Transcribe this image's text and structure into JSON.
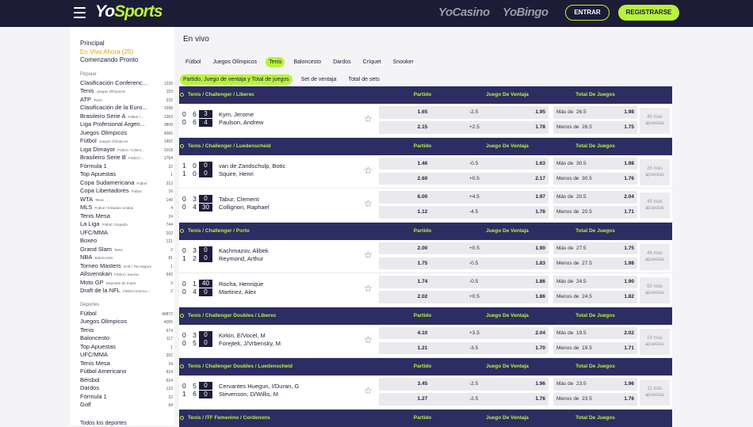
{
  "header": {
    "logo_a": "Yo",
    "logo_b": "Sports",
    "casino": "YoCasino",
    "bingo": "YoBingo",
    "login": "ENTRAR",
    "register": "REGISTRARSE"
  },
  "sidebar": {
    "top": [
      "Principal",
      "En Vivo Ahora (25)",
      "Comenzando Pronto"
    ],
    "popular_title": "Popular",
    "popular": [
      {
        "name": "Clasificación Conferenc...",
        "sub": "",
        "count": "1226"
      },
      {
        "name": "Tenis",
        "sub": "Juegos Olímpicos",
        "count": "153"
      },
      {
        "name": "ATP",
        "sub": "Tenis",
        "count": "232"
      },
      {
        "name": "Clasificación de la Euro...",
        "sub": "",
        "count": "1098"
      },
      {
        "name": "Brasileiro Serie A",
        "sub": "Fútbol /...",
        "count": "1363"
      },
      {
        "name": "Liga Profesional Argen...",
        "sub": "",
        "count": "3809"
      },
      {
        "name": "Juegos Olimpicos",
        "sub": "",
        "count": "4065"
      },
      {
        "name": "Fútbol",
        "sub": "Juegos Olímpicos",
        "count": "1452"
      },
      {
        "name": "Liga Dimayor",
        "sub": "Fútbol / Colom...",
        "count": "1018"
      },
      {
        "name": "Brasileiro Serie B",
        "sub": "Fútbol /...",
        "count": "1754"
      },
      {
        "name": "Fórmula 1",
        "sub": "",
        "count": "22"
      },
      {
        "name": "Top Apuestas",
        "sub": "",
        "count": "1"
      },
      {
        "name": "Copa Sudamericana",
        "sub": "Fútbol",
        "count": "313"
      },
      {
        "name": "Copa Libertadores",
        "sub": "Fútbol",
        "count": "19"
      },
      {
        "name": "WTA",
        "sub": "Tenis",
        "count": "140"
      },
      {
        "name": "MLS",
        "sub": "Fútbol / Estados Unidos",
        "count": "4"
      },
      {
        "name": "Tenis Mesa",
        "sub": "",
        "count": "24"
      },
      {
        "name": "La Liga",
        "sub": "Fútbol / España",
        "count": "744"
      },
      {
        "name": "UFC/MMA",
        "sub": "",
        "count": "202"
      },
      {
        "name": "Boxeo",
        "sub": "",
        "count": "121"
      },
      {
        "name": "Grand Slam",
        "sub": "Tenis",
        "count": "2"
      },
      {
        "name": "NBA",
        "sub": "Baloncesto",
        "count": "81"
      },
      {
        "name": "Torneo Masters",
        "sub": "Golf / The Majors",
        "count": "1"
      },
      {
        "name": "Allsvenskan",
        "sub": "Fútbol / Suecia",
        "count": "642"
      },
      {
        "name": "Moto GP",
        "sub": "Deportes de motor",
        "count": "3"
      },
      {
        "name": "Draft de la NFL",
        "sub": "Fútbol Americo...",
        "count": "2"
      }
    ],
    "sports_title": "Deportes",
    "sports": [
      {
        "name": "Fútbol",
        "count": "49872"
      },
      {
        "name": "Juegos Olimpicos",
        "count": "4065"
      },
      {
        "name": "Tenis",
        "count": "674"
      },
      {
        "name": "Baloncesto",
        "count": "117"
      },
      {
        "name": "Top Apuestas",
        "count": "1"
      },
      {
        "name": "UFC/MMA",
        "count": "202"
      },
      {
        "name": "Tenis Mesa",
        "count": "24"
      },
      {
        "name": "Fútbol Americano",
        "count": "824"
      },
      {
        "name": "Béisbol",
        "count": "524"
      },
      {
        "name": "Dardos",
        "count": "123"
      },
      {
        "name": "Fórmula 1",
        "count": "22"
      },
      {
        "name": "Golf",
        "count": "64"
      }
    ],
    "all_sports": "Todos los deportes"
  },
  "main": {
    "title": "En vivo",
    "sport_tabs": [
      "Fútbol",
      "Juegos Olímpicos",
      "Tenis",
      "Baloncesto",
      "Dardos",
      "Críquet",
      "Snooker"
    ],
    "market_tabs": [
      "Partido, Juego de ventaja y Total de juegos",
      "Set de ventaja",
      "Total de sets"
    ],
    "col_partido": "Partido",
    "col_ventaja": "Juego De Ventaja",
    "col_total": "Total De Juegos",
    "over": "Más de",
    "under": "Menos de"
  },
  "groups": [
    {
      "league": "Tenis / Challenger / Liberec",
      "matches": [
        {
          "s1": "06",
          "s2": "06",
          "c1": "3",
          "c2": "4",
          "p1": "Kym, Jerome",
          "p2": "Paulson, Andrew",
          "o1": "1.65",
          "o2": "2.15",
          "h1": "-2.5",
          "h1o": "1.95",
          "h2": "+2.5",
          "h2o": "1.78",
          "t1": "26.5",
          "t1o": "1.98",
          "t2": "26.5",
          "t2o": "1.75",
          "more": "40 más apuestas"
        }
      ]
    },
    {
      "league": "Tenis / Challenger / Luedenscheid",
      "matches": [
        {
          "s1": "10",
          "s2": "10",
          "c1": "0",
          "c2": "0",
          "p1": "van de Zandschulp, Botic",
          "p2": "Squire, Henri",
          "o1": "1.46",
          "o2": "2.60",
          "h1": "-0.5",
          "h1o": "1.63",
          "h2": "+0.5",
          "h2o": "2.17",
          "t1": "30.5",
          "t1o": "1.98",
          "t2": "30.5",
          "t2o": "1.76",
          "more": "26 más apuestas"
        },
        {
          "s1": "03",
          "s2": "04",
          "c1": "0",
          "c2": "30",
          "p1": "Tabur, Clement",
          "p2": "Collignon, Raphael",
          "o1": "6.00",
          "o2": "1.12",
          "h1": "+4.5",
          "h1o": "1.97",
          "h2": "-4.5",
          "h2o": "1.76",
          "t1": "20.5",
          "t1o": "2.04",
          "t2": "20.5",
          "t2o": "1.71",
          "more": "45 más apuestas"
        }
      ]
    },
    {
      "league": "Tenis / Challenger / Porto",
      "matches": [
        {
          "s1": "03",
          "s2": "12",
          "c1": "0",
          "c2": "0",
          "p1": "Kachmazov, Alibek",
          "p2": "Reymond, Arthur",
          "o1": "2.00",
          "o2": "1.75",
          "h1": "+0.5",
          "h1o": "1.90",
          "h2": "-0.5",
          "h2o": "1.83",
          "t1": "27.5",
          "t1o": "1.75",
          "t2": "27.5",
          "t2o": "1.98",
          "more": "46 más apuestas"
        },
        {
          "s1": "01",
          "s2": "04",
          "c1": "40",
          "c2": "0",
          "p1": "Rocha, Henrique",
          "p2": "Martinez, Alex",
          "o1": "1.74",
          "o2": "2.02",
          "h1": "-0.5",
          "h1o": "1.86",
          "h2": "+0.5",
          "h2o": "1.86",
          "t1": "24.5",
          "t1o": "1.90",
          "t2": "24.5",
          "t2o": "1.82",
          "more": "50 más apuestas"
        }
      ]
    },
    {
      "league": "Tenis / Challenger Doubles / Liberec",
      "matches": [
        {
          "s1": "03",
          "s2": "05",
          "c1": "0",
          "c2": "0",
          "p1": "Kirkin, E/Vocel, M",
          "p2": "Forejtek, J/Vrbensky, M",
          "o1": "4.10",
          "o2": "1.21",
          "h1": "+3.5",
          "h1o": "2.04",
          "h2": "-3.5",
          "h2o": "1.70",
          "t1": "19.5",
          "t1o": "2.02",
          "t2": "19.5",
          "t2o": "1.71",
          "more": "19 más apuestas"
        }
      ]
    },
    {
      "league": "Tenis / Challenger Doubles / Luedenscheid",
      "matches": [
        {
          "s1": "05",
          "s2": "16",
          "c1": "0",
          "c2": "0",
          "p1": "Cervantes Huegun, I/Duran, G",
          "p2": "Stevenson, D/Willis, M",
          "o1": "3.45",
          "o2": "1.27",
          "h1": "-2.5",
          "h1o": "1.96",
          "h2": "-2.5",
          "h2o": "1.76",
          "t1": "23.5",
          "t1o": "1.96",
          "t2": "23.5",
          "t2o": "1.76",
          "more": "11 más apuestas"
        }
      ]
    },
    {
      "league": "Tenis / ITF Femenino / Cordenons",
      "matches": []
    }
  ]
}
